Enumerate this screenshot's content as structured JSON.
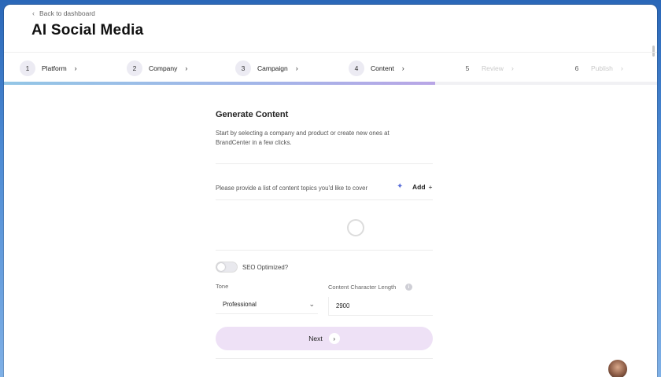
{
  "header": {
    "back_link": "Back to dashboard",
    "title": "AI Social Media"
  },
  "steps": [
    {
      "num": "1",
      "label": "Platform",
      "state": "done"
    },
    {
      "num": "2",
      "label": "Company",
      "state": "done"
    },
    {
      "num": "3",
      "label": "Campaign",
      "state": "done"
    },
    {
      "num": "4",
      "label": "Content",
      "state": "current"
    },
    {
      "num": "5",
      "label": "Review",
      "state": "disabled"
    },
    {
      "num": "6",
      "label": "Publish",
      "state": "disabled"
    }
  ],
  "progress": {
    "fraction": 0.66
  },
  "main": {
    "title": "Generate Content",
    "description": "Start by selecting a company and product or create new ones at BrandCenter in a few clicks.",
    "topics_prompt": "Please provide a list of content topics you'd like to cover",
    "add_label": "Add",
    "seo_label": "SEO Optimized?",
    "seo_enabled": false,
    "tone_label": "Tone",
    "tone_value": "Professional",
    "length_label": "Content Character Length",
    "length_value": "2900",
    "next_label": "Next"
  },
  "colors": {
    "accent_button": "#eee1f6",
    "step_circle": "#ecebf3",
    "progress_start": "#93c6e6",
    "progress_end": "#b9a6e6",
    "desktop": "#2a67b8"
  }
}
